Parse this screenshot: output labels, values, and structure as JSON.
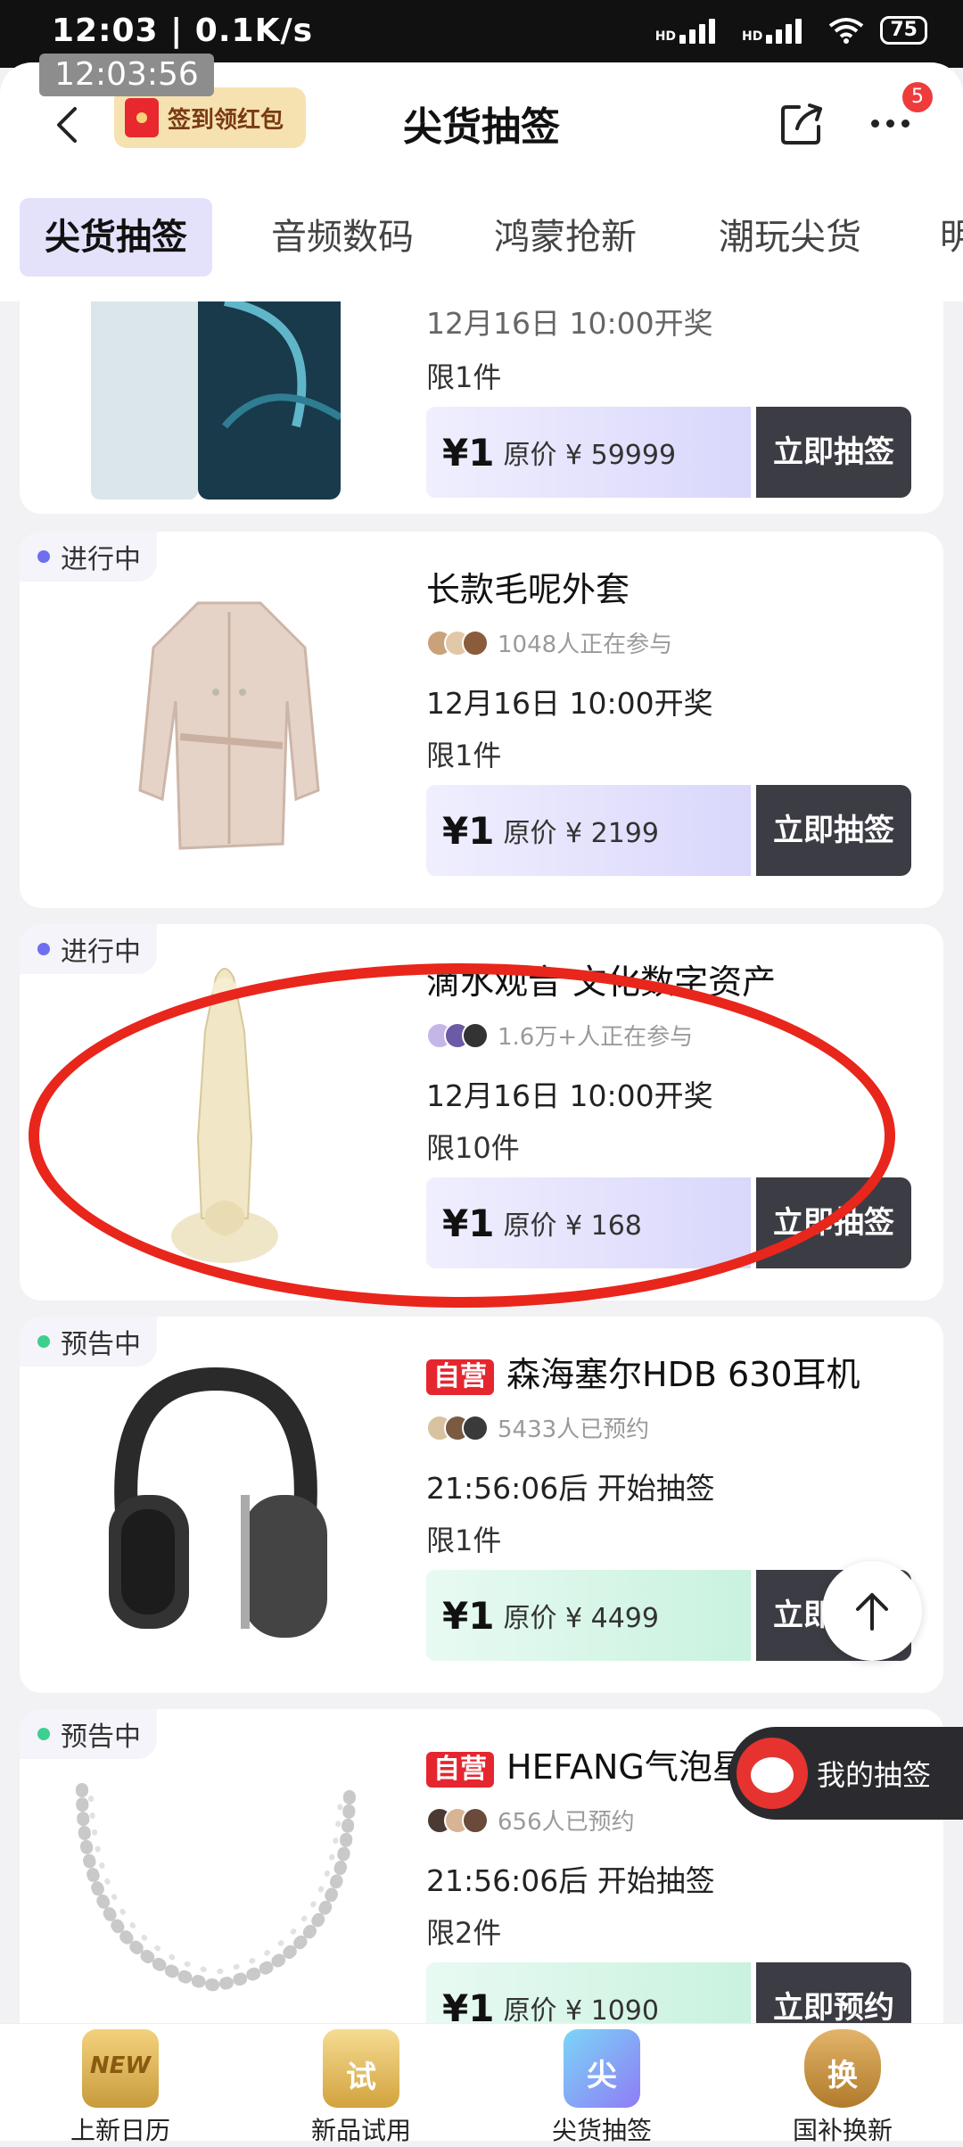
{
  "status_bar": {
    "time": "12:03 | 0.1K/s",
    "battery": "75",
    "hd1": "HD",
    "hd2": "HD"
  },
  "overlay_clock": "12:03:56",
  "header": {
    "signin_label": "签到领红包",
    "title": "尖货抽签",
    "more_badge": "5"
  },
  "tabs": [
    {
      "label": "尖货抽签",
      "active": true
    },
    {
      "label": "音频数码"
    },
    {
      "label": "鸿蒙抢新"
    },
    {
      "label": "潮玩尖货"
    },
    {
      "label": "明"
    }
  ],
  "items": [
    {
      "status": "",
      "title": "",
      "participants": "",
      "time": "12月16日 10:00开奖",
      "limit": "限1件",
      "price": "¥1",
      "original": "原价 ¥ 59999",
      "action": "立即抽签",
      "tone": "purple"
    },
    {
      "status": "进行中",
      "title": "长款毛呢外套",
      "participants": "1048人正在参与",
      "time": "12月16日 10:00开奖",
      "limit": "限1件",
      "price": "¥1",
      "original": "原价 ¥ 2199",
      "action": "立即抽签",
      "tone": "purple"
    },
    {
      "status": "进行中",
      "title": "滴水观音 文化数字资产",
      "participants": "1.6万+人正在参与",
      "time": "12月16日 10:00开奖",
      "limit": "限10件",
      "price": "¥1",
      "original": "原价 ¥ 168",
      "action": "立即抽签",
      "tone": "purple"
    },
    {
      "status": "预告中",
      "self_label": "自营",
      "title": "森海塞尔HDB 630耳机",
      "participants": "5433人已预约",
      "time": "21:56:06后 开始抽签",
      "limit": "限1件",
      "price": "¥1",
      "original": "原价 ¥ 4499",
      "action": "立即预约",
      "tone": "green"
    },
    {
      "status": "预告中",
      "self_label": "自营",
      "title": "HEFANG气泡星河项链",
      "participants": "656人已预约",
      "time": "21:56:06后 开始抽签",
      "limit": "限2件",
      "price": "¥1",
      "original": "原价 ¥ 1090",
      "action": "立即预约",
      "tone": "purple"
    }
  ],
  "floating": {
    "my_draw": "我的抽签"
  },
  "bottom_nav": [
    {
      "label": "上新日历",
      "icon": "calendar-new-icon",
      "icon_text": "NEW"
    },
    {
      "label": "新品试用",
      "icon": "trial-bag-icon",
      "icon_text": "试"
    },
    {
      "label": "尖货抽签",
      "icon": "lottery-icon",
      "icon_text": "尖"
    },
    {
      "label": "国补换新",
      "icon": "trade-in-shield-icon",
      "icon_text": "换"
    }
  ]
}
